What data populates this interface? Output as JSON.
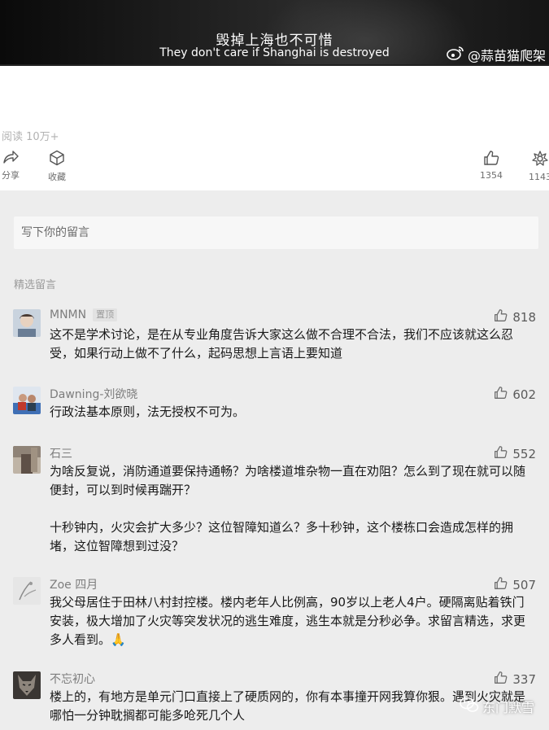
{
  "video": {
    "subtitle_cn": "毁掉上海也不可惜",
    "subtitle_en": "They don't care if Shanghai is destroyed",
    "watermark": "@蒜苗猫爬架",
    "watermark_icon": "weibo-icon"
  },
  "article": {
    "reads": "阅读 10万+"
  },
  "actions": {
    "share_label": "分享",
    "share_icon": "share-icon",
    "favorite_label": "收藏",
    "favorite_icon": "cube-icon",
    "like_count": "1354",
    "like_icon": "thumbs-up-icon",
    "wow_count": "1143",
    "wow_icon": "flower-icon"
  },
  "comments_area": {
    "write_placeholder": "写下你的留言",
    "section_title": "精选留言",
    "comments": [
      {
        "name": "MNMN",
        "tag": "置顶",
        "likes": "818",
        "avatar_color": "#a8b3c0",
        "text": "这不是学术讨论，是在从专业角度告诉大家这么做不合理不合法，我们不应该就这么忍受，如果行动上做不了什么，起码思想上言语上要知道"
      },
      {
        "name": "Dawning-刘欲晓",
        "tag": "",
        "likes": "602",
        "avatar_color": "#3f6fb5",
        "text": "行政法基本原则，法无授权不可为。"
      },
      {
        "name": "石三",
        "tag": "",
        "likes": "552",
        "avatar_color": "#8a7a6a",
        "text": "为啥反复说，消防通道要保持通畅？为啥楼道堆杂物一直在劝阻？怎么到了现在就可以随便封，可以到时候再踹开？\n\n十秒钟内，火灾会扩大多少？这位智障知道么？多十秒钟，这个楼栋口会造成怎样的拥堵，这位智障想到过没？"
      },
      {
        "name": "Zoe 四月",
        "tag": "",
        "likes": "507",
        "avatar_color": "#d9d9d9",
        "text": "我父母居住于田林八村封控楼。楼内老年人比例高，90岁以上老人4户。硬隔离贴着铁门安装，极大增加了火灾等突发状况的逃生难度，逃生本就是分秒必争。求留言精选，求更多人看到。🙏"
      },
      {
        "name": "不忘初心",
        "tag": "",
        "likes": "337",
        "avatar_color": "#5a5550",
        "text": "楼上的，有地方是单元门口直接上了硬质网的，你有本事撞开网我算你狠。遇到火灾就是哪怕一分钟耽搁都可能多呛死几个人"
      }
    ]
  },
  "bottom_watermark": {
    "text": "东门默雪",
    "icon": "wechat-icon"
  }
}
